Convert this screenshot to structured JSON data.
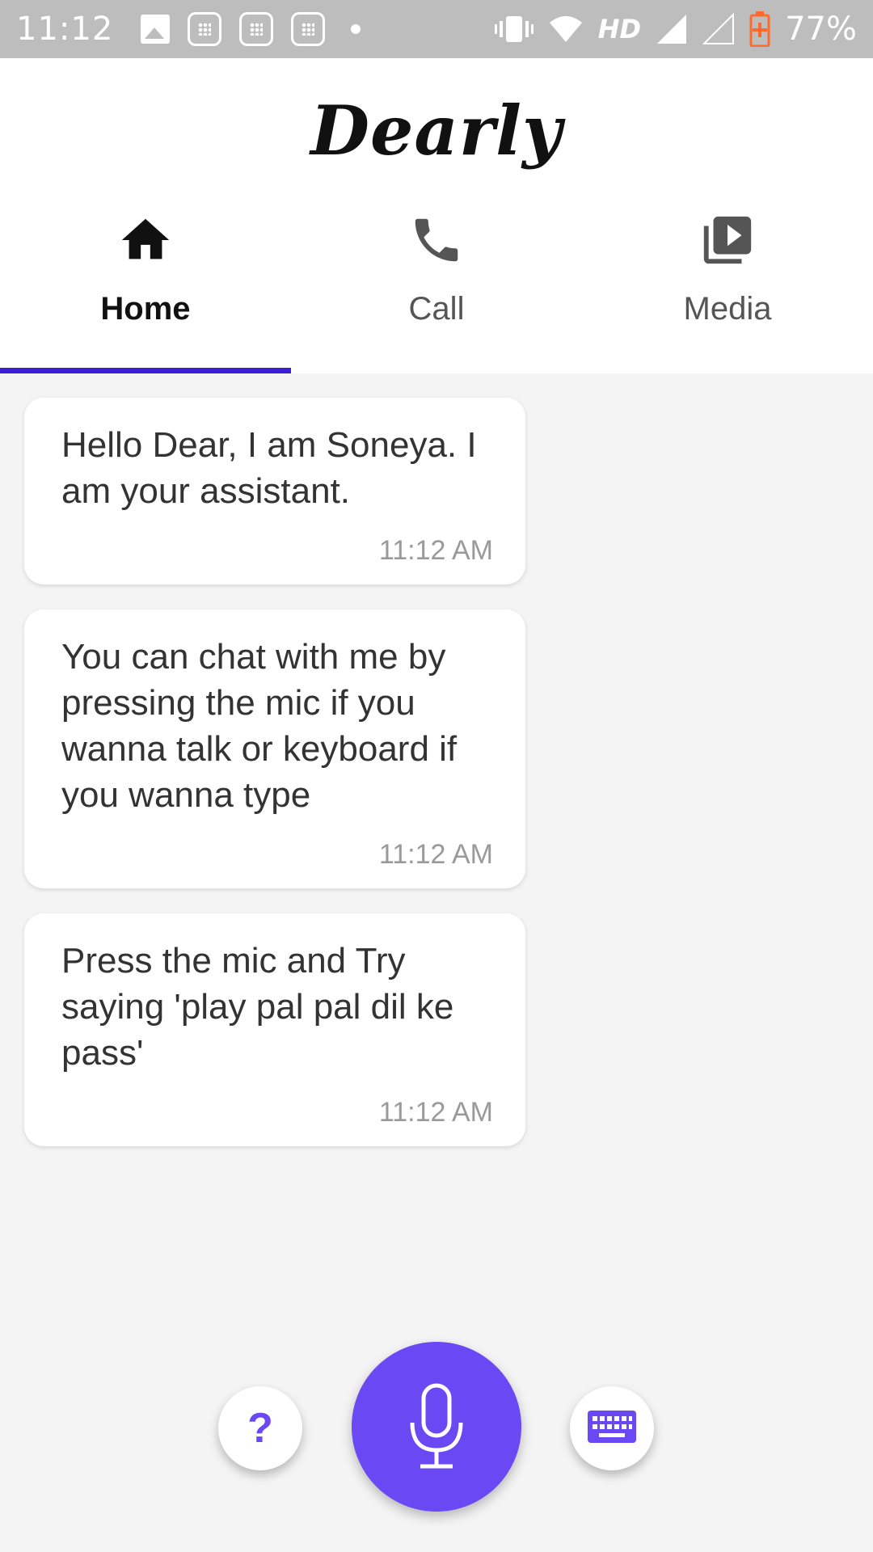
{
  "status_bar": {
    "time": "11:12",
    "network_label": "HD",
    "battery_percent": "77%"
  },
  "header": {
    "app_title": "Dearly"
  },
  "tabs": [
    {
      "label": "Home",
      "icon": "home-icon",
      "active": true
    },
    {
      "label": "Call",
      "icon": "phone-icon",
      "active": false
    },
    {
      "label": "Media",
      "icon": "video-library-icon",
      "active": false
    }
  ],
  "messages": [
    {
      "text": "Hello Dear, I am Soneya. I am your assistant.",
      "time": "11:12 AM"
    },
    {
      "text": "You can chat with me by pressing the mic if you wanna talk or keyboard if you wanna type",
      "time": "11:12 AM"
    },
    {
      "text": "Press the mic and Try saying 'play pal pal dil ke pass'",
      "time": "11:12 AM"
    }
  ],
  "actions": {
    "help_label": "?",
    "mic_icon": "microphone-icon",
    "keyboard_icon": "keyboard-icon"
  },
  "colors": {
    "accent": "#6a48f4",
    "tab_indicator": "#3b1fd6",
    "status_bar": "#bdbdbd",
    "background": "#f4f4f4"
  }
}
